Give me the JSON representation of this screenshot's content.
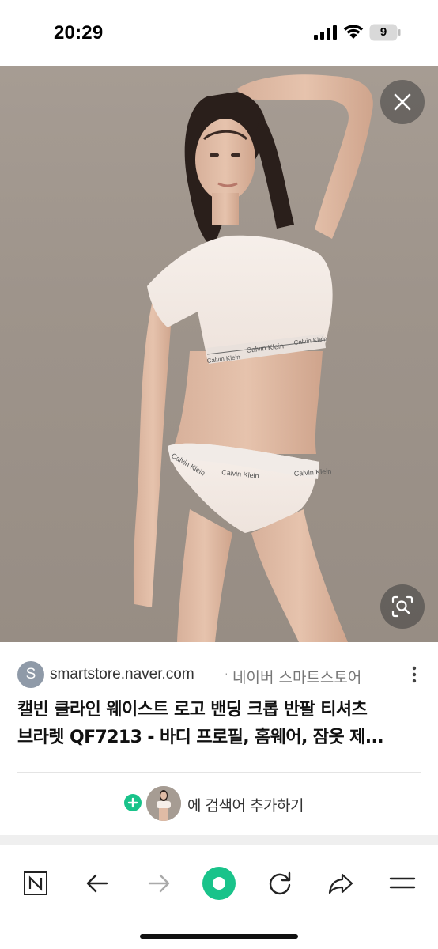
{
  "status_bar": {
    "time": "20:29",
    "battery_level": "9",
    "icons": [
      "signal-icon",
      "wifi-icon",
      "battery-icon"
    ]
  },
  "viewer": {
    "close_icon": "close-icon",
    "lens_icon": "image-search-icon",
    "photo_text": {
      "brand_top_left": "Calvin Klein",
      "brand_top_center": "Calvin Klein",
      "brand_top_right": "Calvin Klein",
      "brand_bottom_left": "Calvin Klein",
      "brand_bottom_center": "Calvin Klein",
      "brand_bottom_right": "Calvin Klein"
    }
  },
  "source": {
    "avatar_letter": "S",
    "domain": "smartstore.naver.com",
    "separator": "·",
    "name": "네이버 스마트스토어",
    "menu_icon": "more-vertical-icon"
  },
  "result": {
    "title_line1": "캘빈 클라인 웨이스트 로고 밴딩 크롭 반팔 티셔츠",
    "title_line2": "브라렛 QF7213 - 바디 프로필, 홈웨어, 잠옷 제..."
  },
  "add_keyword": {
    "plus_icon": "plus-circle-icon",
    "label": "에 검색어 추가하기"
  },
  "bottom_nav": {
    "items": [
      "naver-home-icon",
      "back-arrow-icon",
      "forward-arrow-icon",
      "green-dot-icon",
      "refresh-icon",
      "share-icon",
      "menu-icon"
    ]
  },
  "colors": {
    "accent_green": "#19c38a",
    "background_beige": "#a69c93",
    "overlay_button": "#3c3c3c"
  }
}
